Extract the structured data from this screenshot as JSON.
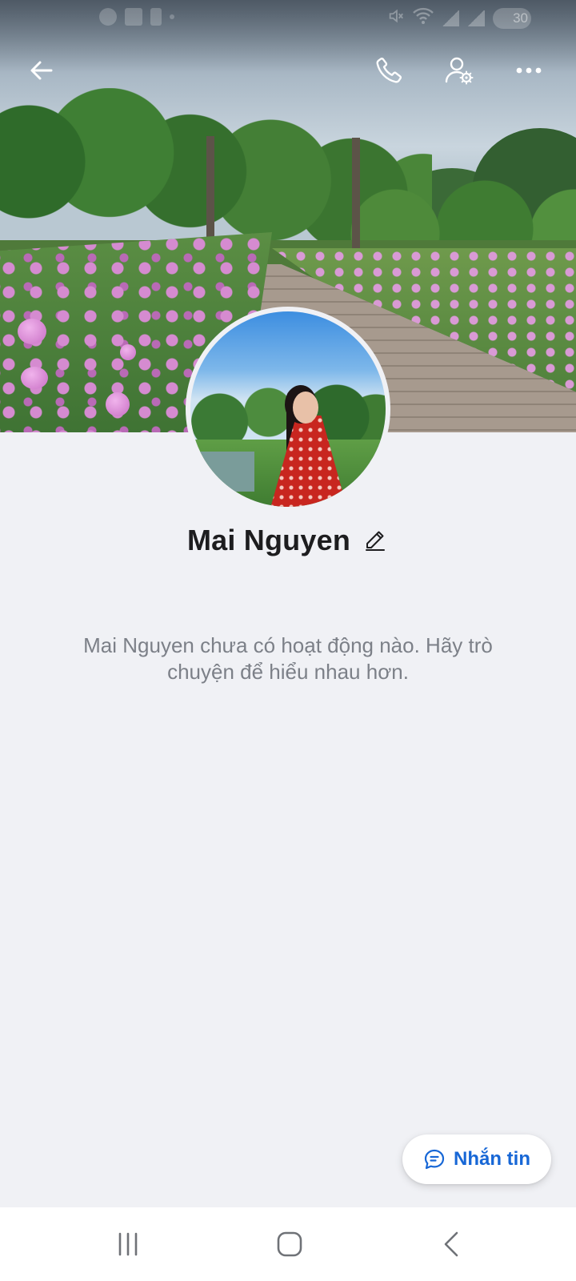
{
  "status_bar": {
    "battery": "30",
    "left_icons": [
      "facebook-icon",
      "news-icon",
      "facebook-f-icon",
      "dot-icon"
    ],
    "right_icons": [
      "mute-icon",
      "wifi-icon",
      "signal-icon",
      "signal-icon",
      "battery-icon"
    ]
  },
  "top_bar": {
    "icons": [
      "arrow-left-icon",
      "phone-icon",
      "user-settings-icon",
      "more-horizontal-icon"
    ]
  },
  "profile": {
    "name": "Mai Nguyen",
    "empty_message": "Mai Nguyen chưa có hoạt động nào. Hãy trò chuyện để hiểu nhau hơn."
  },
  "message_button": {
    "label": "Nhắn tin",
    "icon": "chat-bubble-icon"
  },
  "nav_bar": {
    "icons": [
      "recent-apps-icon",
      "home-icon",
      "back-chevron-icon"
    ]
  },
  "colors": {
    "background": "#f0f1f5",
    "accent": "#1767d6",
    "name_text": "#1d1d1f",
    "secondary_text": "#7c8088"
  }
}
